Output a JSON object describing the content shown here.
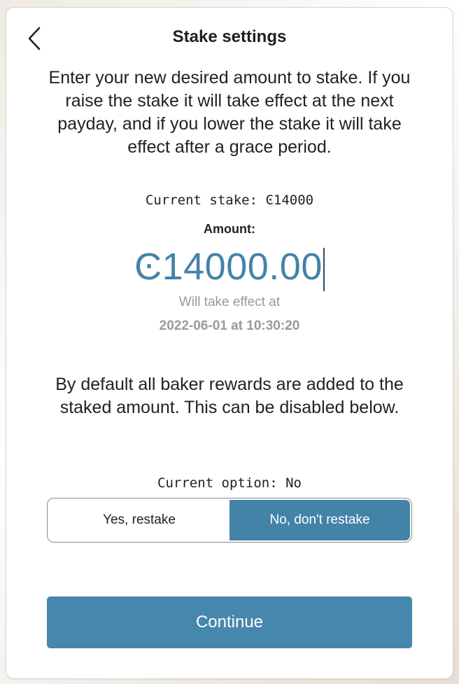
{
  "header": {
    "title": "Stake settings",
    "back_icon": "chevron-left-icon"
  },
  "intro_text": "Enter your new desired amount to stake. If you raise the stake it will take effect at the next payday, and if you lower the stake it will take effect after a grace period.",
  "stake": {
    "current_stake_text": "Current stake: Ͼ14000",
    "amount_label": "Amount:",
    "amount_value": "Ͼ14000.00",
    "effect_label": "Will take effect at",
    "effect_date": "2022-06-01 at 10:30:20"
  },
  "restake": {
    "info_text": "By default all baker rewards are added to the staked amount. This can be disabled below.",
    "current_option_text": "Current option: No",
    "options": [
      {
        "label": "Yes, restake",
        "selected": false
      },
      {
        "label": "No, don't restake",
        "selected": true
      }
    ]
  },
  "continue_label": "Continue",
  "colors": {
    "accent": "#4383a8",
    "muted_text": "#9a9a9a"
  }
}
